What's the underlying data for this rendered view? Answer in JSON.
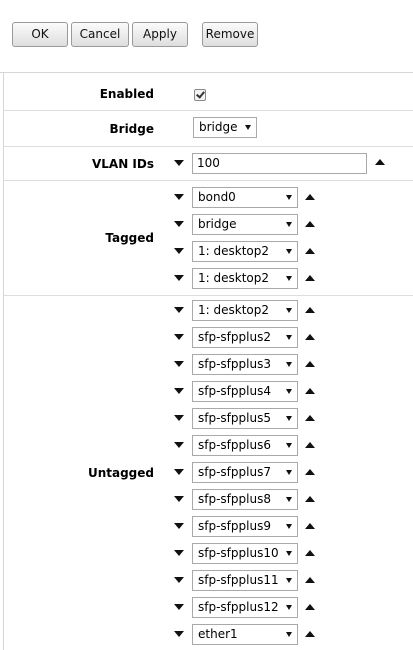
{
  "toolbar": {
    "ok": "OK",
    "cancel": "Cancel",
    "apply": "Apply",
    "remove": "Remove"
  },
  "fields": {
    "enabled": {
      "label": "Enabled",
      "checked": true
    },
    "bridge": {
      "label": "Bridge",
      "value": "bridge"
    },
    "vlan_ids": {
      "label": "VLAN IDs",
      "value": "100"
    },
    "tagged": {
      "label": "Tagged",
      "items": [
        "bond0",
        "bridge",
        "1: desktop2",
        "1: desktop2"
      ]
    },
    "untagged": {
      "label": "Untagged",
      "items": [
        "1: desktop2",
        "sfp-sfpplus2",
        "sfp-sfpplus3",
        "sfp-sfpplus4",
        "sfp-sfpplus5",
        "sfp-sfpplus6",
        "sfp-sfpplus7",
        "sfp-sfpplus8",
        "sfp-sfpplus9",
        "sfp-sfpplus10",
        "sfp-sfpplus11",
        "sfp-sfpplus12",
        "ether1"
      ]
    }
  }
}
